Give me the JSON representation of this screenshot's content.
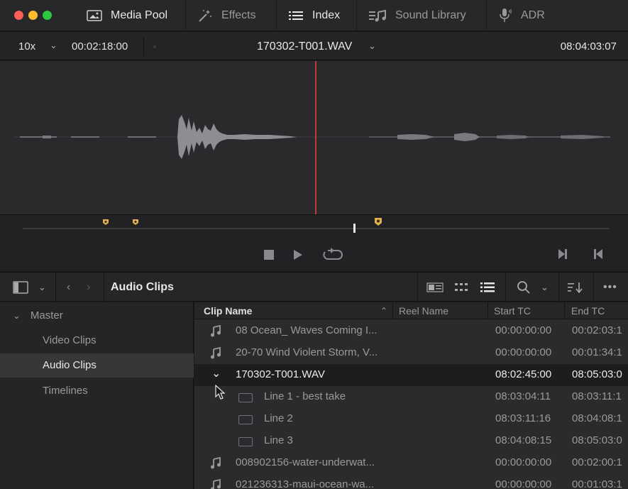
{
  "top_tabs": [
    {
      "label": "Media Pool",
      "icon": "media-pool-icon",
      "active": true
    },
    {
      "label": "Effects",
      "icon": "effects-wand-icon",
      "active": false
    },
    {
      "label": "Index",
      "icon": "index-list-icon",
      "active": true
    },
    {
      "label": "Sound Library",
      "icon": "sound-library-icon",
      "active": false
    },
    {
      "label": "ADR",
      "icon": "microphone-icon",
      "active": false
    }
  ],
  "viewer": {
    "zoom": "10x",
    "timecode_left": "00:02:18:00",
    "clip_name": "170302-T001.WAV",
    "timecode_right": "08:04:03:07"
  },
  "bin": {
    "title": "Audio Clips"
  },
  "sidebar": {
    "root": "Master",
    "items": [
      {
        "label": "Video Clips",
        "selected": false
      },
      {
        "label": "Audio Clips",
        "selected": true
      },
      {
        "label": "Timelines",
        "selected": false
      }
    ]
  },
  "table": {
    "columns": [
      "Clip Name",
      "Reel Name",
      "Start TC",
      "End TC"
    ],
    "rows": [
      {
        "name": "08 Ocean_ Waves Coming I...",
        "start": "00:00:00:00",
        "end": "00:02:03:1",
        "type": "audio"
      },
      {
        "name": "20-70 Wind Violent Storm, V...",
        "start": "00:00:00:00",
        "end": "00:01:34:1",
        "type": "audio"
      },
      {
        "name": "170302-T001.WAV",
        "start": "08:02:45:00",
        "end": "08:05:03:0",
        "type": "expanded"
      },
      {
        "name": "Line 1 - best take",
        "start": "08:03:04:11",
        "end": "08:03:11:1",
        "type": "subclip"
      },
      {
        "name": "Line 2",
        "start": "08:03:11:16",
        "end": "08:04:08:1",
        "type": "subclip"
      },
      {
        "name": "Line 3",
        "start": "08:04:08:15",
        "end": "08:05:03:0",
        "type": "subclip"
      },
      {
        "name": "008902156-water-underwat...",
        "start": "00:00:00:00",
        "end": "00:02:00:1",
        "type": "audio"
      },
      {
        "name": "021236313-maui-ocean-wa...",
        "start": "00:00:00:00",
        "end": "00:01:03:1",
        "type": "audio"
      }
    ]
  },
  "colors": {
    "close": "#fc5f57",
    "minimize": "#fdbc2e",
    "maximize": "#2bc840",
    "playhead": "#c0393b",
    "marker": "#e3b04b",
    "waveform": "#8e8e92"
  }
}
